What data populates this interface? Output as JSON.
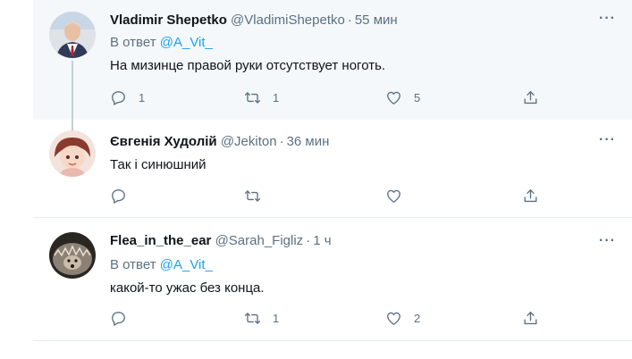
{
  "tweets": [
    {
      "name": "Vladimir Shepetko",
      "handle": "@VladimiShepetko",
      "separator": "·",
      "time": "55 мин",
      "reply_prefix": "В ответ",
      "reply_to": "@A_Vit_",
      "text": "На мизинце правой руки отсутствует ноготь.",
      "replies": "1",
      "retweets": "1",
      "likes": "5",
      "more": "···"
    },
    {
      "name": "Євгенія Худолій",
      "handle": "@Jekiton",
      "separator": "·",
      "time": "36 мин",
      "text": "Так і синюшний",
      "replies": "",
      "retweets": "",
      "likes": "",
      "more": "···"
    },
    {
      "name": "Flea_in_the_ear",
      "handle": "@Sarah_Figliz",
      "separator": "·",
      "time": "1 ч",
      "reply_prefix": "В ответ",
      "reply_to": "@A_Vit_",
      "text": "какой-то ужас без конца.",
      "replies": "",
      "retweets": "1",
      "likes": "2",
      "more": "···"
    }
  ],
  "icons": [
    "reply-icon",
    "retweet-icon",
    "like-icon",
    "share-icon",
    "more-icon"
  ],
  "colors": {
    "link": "#1da1f2",
    "muted": "#5b7083",
    "highlight_bg": "#f5f8fa"
  }
}
